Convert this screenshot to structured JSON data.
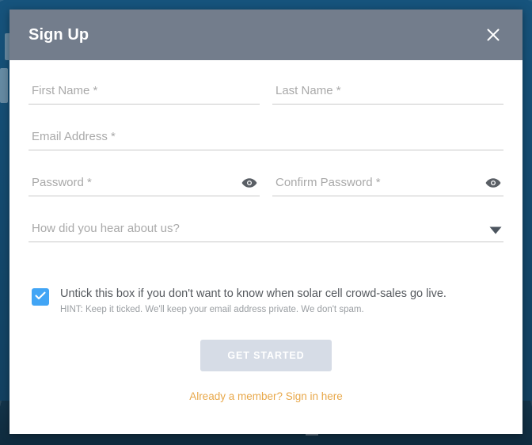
{
  "backdrop": {
    "color": "#135a87",
    "bottom_strip_color": "#13344a"
  },
  "modal": {
    "header": {
      "title": "Sign Up",
      "background": "#737d8c",
      "close_icon": "close-icon"
    },
    "fields": [
      {
        "name": "first-name",
        "placeholder": "First Name *",
        "value": "",
        "type": "text",
        "icon": null
      },
      {
        "name": "last-name",
        "placeholder": "Last Name *",
        "value": "",
        "type": "text",
        "icon": null
      },
      {
        "name": "email-address",
        "placeholder": "Email Address *",
        "value": "",
        "type": "email",
        "icon": null
      },
      {
        "name": "password",
        "placeholder": "Password *",
        "value": "",
        "type": "password",
        "icon": "eye-icon"
      },
      {
        "name": "confirm-password",
        "placeholder": "Confirm Password *",
        "value": "",
        "type": "password",
        "icon": "eye-icon"
      }
    ],
    "referral": {
      "placeholder": "How did you hear about us?",
      "selected": "How did you hear about us?",
      "chevron_icon": "chevron-down-icon"
    },
    "newsletter": {
      "checked": true,
      "checkbox_color": "#42a5f5",
      "check_icon": "check-icon",
      "label": "Untick this box if you don't want to know when solar cell crowd-sales go live.",
      "hint": "HINT: Keep it ticked. We'll keep your email address private. We don't spam."
    },
    "actions": {
      "submit_label": "GET STARTED",
      "submit_color": "#d6dce6",
      "signin_label": "Already a member? Sign in here",
      "signin_color": "#e8a84a"
    }
  }
}
